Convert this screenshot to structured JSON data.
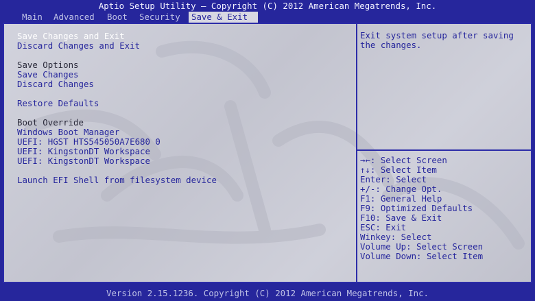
{
  "title": "Aptio Setup Utility – Copyright (C) 2012 American Megatrends, Inc.",
  "tabs": [
    {
      "label": "Main"
    },
    {
      "label": "Advanced"
    },
    {
      "label": "Boot"
    },
    {
      "label": "Security"
    },
    {
      "label": "Save & Exit",
      "active": true
    }
  ],
  "menu": {
    "save_changes_and_exit": "Save Changes and Exit",
    "discard_changes_and_exit": "Discard Changes and Exit",
    "save_options_heading": "Save Options",
    "save_changes": "Save Changes",
    "discard_changes": "Discard Changes",
    "restore_defaults": "Restore Defaults",
    "boot_override_heading": "Boot Override",
    "boot_options": [
      "Windows Boot Manager",
      "UEFI: HGST HTS545050A7E680 0",
      "UEFI: KingstonDT Workspace",
      "UEFI: KingstonDT Workspace"
    ],
    "launch_efi_shell": "Launch EFI Shell from filesystem device"
  },
  "help_text": "Exit system setup after saving\nthe changes.",
  "key_help": [
    "→←: Select Screen",
    "↑↓: Select Item",
    "Enter: Select",
    "+/-: Change Opt.",
    "F1: General Help",
    "F9: Optimized Defaults",
    "F10: Save & Exit",
    "ESC: Exit",
    "Winkey: Select",
    "Volume Up: Select Screen",
    "Volume Down: Select Item"
  ],
  "footer": "Version 2.15.1236. Copyright (C) 2012 American Megatrends, Inc.",
  "colors": {
    "frame_blue": "#26269c",
    "panel_gray": "#cbccd6",
    "highlight_white": "#ffffff"
  }
}
